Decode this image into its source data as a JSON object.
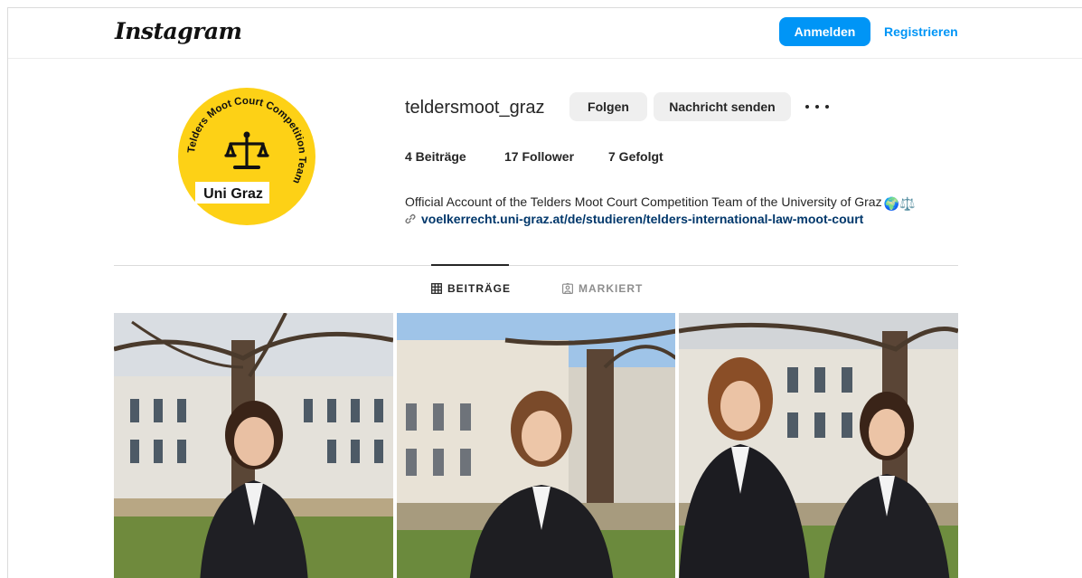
{
  "header": {
    "logo": "Instagram",
    "login_label": "Anmelden",
    "register_label": "Registrieren"
  },
  "avatar": {
    "ring_text": "Telders Moot Court Competition Team",
    "badge_text": "Uni Graz",
    "color": "#fdd116"
  },
  "profile": {
    "username": "teldersmoot_graz",
    "follow_label": "Folgen",
    "message_label": "Nachricht senden",
    "stats": {
      "posts": "4 Beiträge",
      "followers": "17 Follower",
      "following": "7 Gefolgt"
    },
    "bio": "Official Account of the Telders Moot Court Competition Team of the University of Graz",
    "bio_emoji": "🌍⚖️",
    "link": "voelkerrecht.uni-graz.at/de/studieren/telders-international-law-moot-court"
  },
  "tabs": [
    {
      "label": "BEITRÄGE",
      "active": true
    },
    {
      "label": "MARKIERT",
      "active": false
    }
  ],
  "posts": [
    {
      "id": "post-1"
    },
    {
      "id": "post-2"
    },
    {
      "id": "post-3"
    }
  ],
  "colors": {
    "accent": "#0095f6",
    "link": "#00376b",
    "button_grey": "#efefef"
  }
}
